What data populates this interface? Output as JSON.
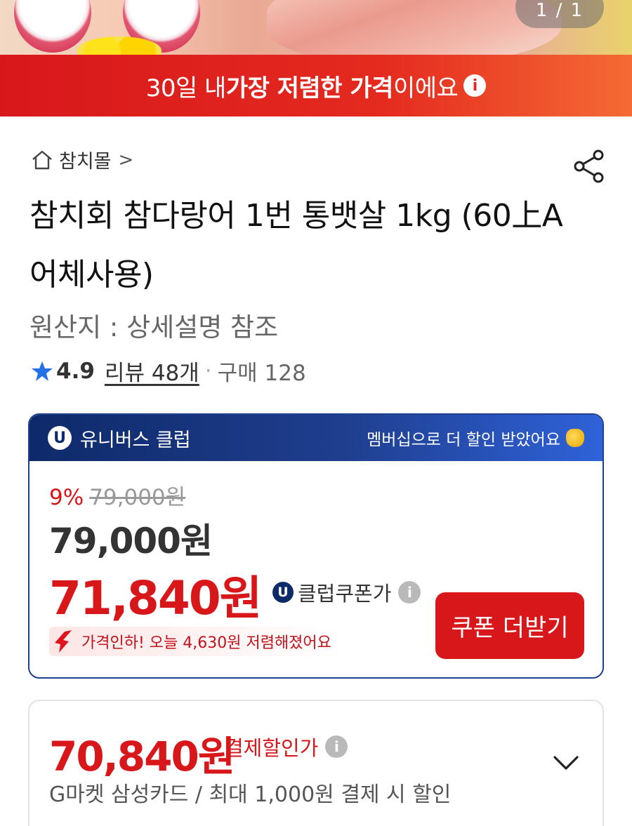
{
  "hero": {
    "image_counter": "1 / 1"
  },
  "banner": {
    "prefix": "30일 내 ",
    "highlight": "가장 저렴한 가격",
    "suffix": "이에요",
    "info_icon": "info-icon"
  },
  "breadcrumb": {
    "store": "참치몰",
    "chevron": ">"
  },
  "product": {
    "title": "참치회 참다랑어 1번 통뱃살 1kg (60上A 어체사용)",
    "origin": "원산지 : 상세설명 참조",
    "rating": "4.9",
    "reviews": "리뷰 48개",
    "separator": "·",
    "purchases": "구매 128"
  },
  "club": {
    "badge": "U",
    "name": "유니버스 클럽",
    "message": "멤버십으로 더 할인 받았어요",
    "discount_rate": "9%",
    "original_price": "79,000원",
    "price": "79,000원",
    "club_price": "71,840원",
    "club_price_label": "클럽쿠폰가",
    "price_drop_note": "가격인하! 오늘 4,630원 저렴해졌어요",
    "coupon_button": "쿠폰 더받기"
  },
  "payment": {
    "price": "70,840원",
    "label": "결제할인가",
    "description": "G마켓 삼성카드 / 최대 1,000원 결제 시 할인"
  },
  "colors": {
    "accent_red": "#d8171b",
    "club_navy": "#0e2a6a",
    "club_blue": "#2f62d9"
  }
}
